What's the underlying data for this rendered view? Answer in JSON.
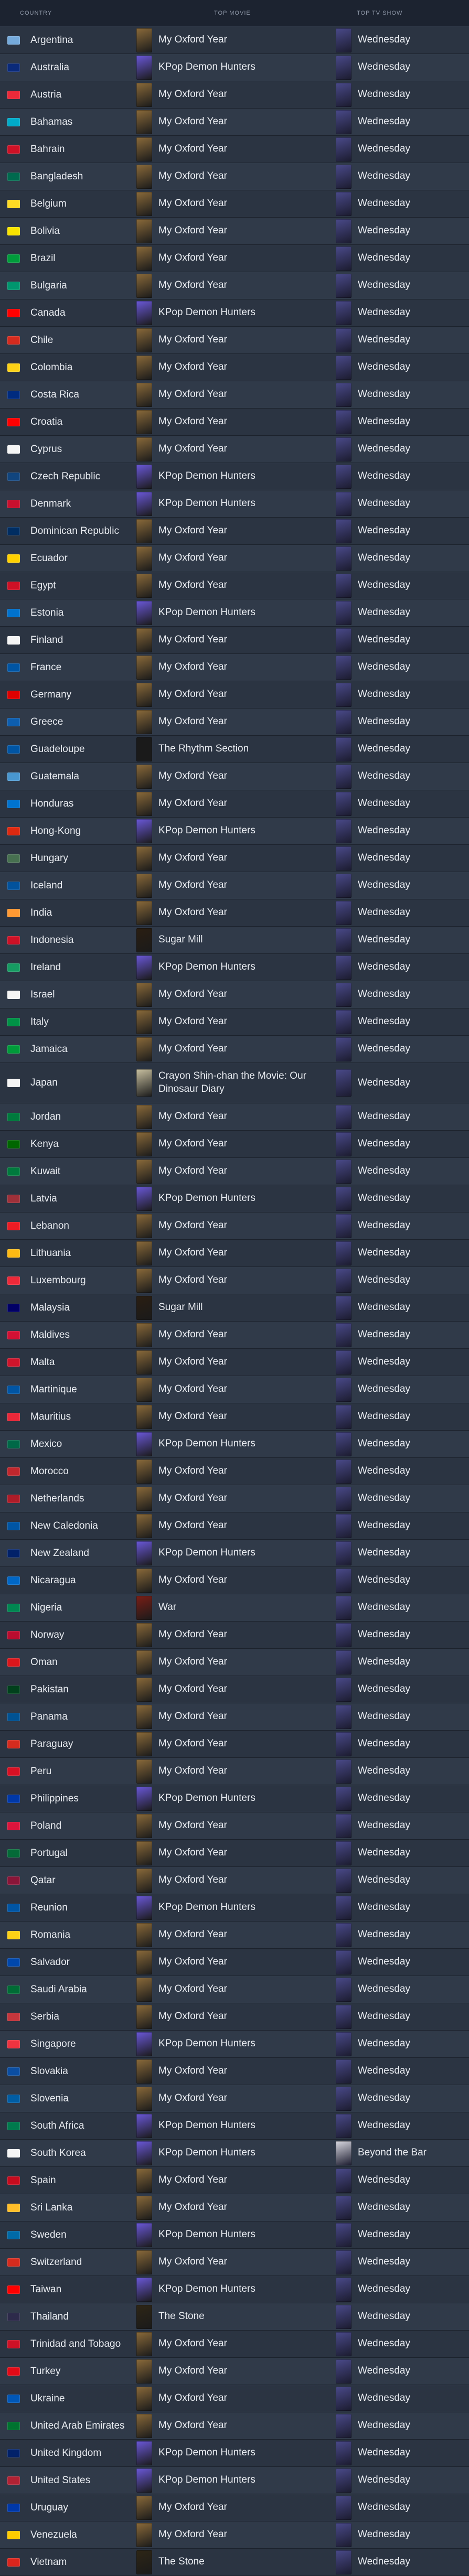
{
  "headers": {
    "country": "COUNTRY",
    "movie": "TOP MOVIE",
    "show": "TOP TV SHOW"
  },
  "posters": {
    "my_oxford_year": "#8a6a3a",
    "kpop_demon_hunters": "#6a58d8",
    "wednesday": "#4a4a8a",
    "rhythm_section": "#1a1a1a",
    "sugar_mill": "#2a1e12",
    "crayon_shinchan": "#c8c0a0",
    "war": "#7a1e16",
    "the_stone": "#2e2616",
    "beyond_the_bar": "#d8d8e0"
  },
  "rows": [
    {
      "country": "Argentina",
      "movie": "My Oxford Year",
      "show": "Wednesday",
      "flag": "#75aadb"
    },
    {
      "country": "Australia",
      "movie": "KPop Demon Hunters",
      "show": "Wednesday",
      "flag": "#0a2a7a"
    },
    {
      "country": "Austria",
      "movie": "My Oxford Year",
      "show": "Wednesday",
      "flag": "#ed2939"
    },
    {
      "country": "Bahamas",
      "movie": "My Oxford Year",
      "show": "Wednesday",
      "flag": "#00abc9"
    },
    {
      "country": "Bahrain",
      "movie": "My Oxford Year",
      "show": "Wednesday",
      "flag": "#ce1126"
    },
    {
      "country": "Bangladesh",
      "movie": "My Oxford Year",
      "show": "Wednesday",
      "flag": "#006a4e"
    },
    {
      "country": "Belgium",
      "movie": "My Oxford Year",
      "show": "Wednesday",
      "flag": "#fdda24"
    },
    {
      "country": "Bolivia",
      "movie": "My Oxford Year",
      "show": "Wednesday",
      "flag": "#f9e300"
    },
    {
      "country": "Brazil",
      "movie": "My Oxford Year",
      "show": "Wednesday",
      "flag": "#009c3b"
    },
    {
      "country": "Bulgaria",
      "movie": "My Oxford Year",
      "show": "Wednesday",
      "flag": "#00966e"
    },
    {
      "country": "Canada",
      "movie": "KPop Demon Hunters",
      "show": "Wednesday",
      "flag": "#ff0000"
    },
    {
      "country": "Chile",
      "movie": "My Oxford Year",
      "show": "Wednesday",
      "flag": "#d52b1e"
    },
    {
      "country": "Colombia",
      "movie": "My Oxford Year",
      "show": "Wednesday",
      "flag": "#fcd116"
    },
    {
      "country": "Costa Rica",
      "movie": "My Oxford Year",
      "show": "Wednesday",
      "flag": "#002b7f"
    },
    {
      "country": "Croatia",
      "movie": "My Oxford Year",
      "show": "Wednesday",
      "flag": "#ff0000"
    },
    {
      "country": "Cyprus",
      "movie": "My Oxford Year",
      "show": "Wednesday",
      "flag": "#f5f5f5"
    },
    {
      "country": "Czech Republic",
      "movie": "KPop Demon Hunters",
      "show": "Wednesday",
      "flag": "#11457e"
    },
    {
      "country": "Denmark",
      "movie": "KPop Demon Hunters",
      "show": "Wednesday",
      "flag": "#c8102e"
    },
    {
      "country": "Dominican Republic",
      "movie": "My Oxford Year",
      "show": "Wednesday",
      "flag": "#002d62"
    },
    {
      "country": "Ecuador",
      "movie": "My Oxford Year",
      "show": "Wednesday",
      "flag": "#ffd100"
    },
    {
      "country": "Egypt",
      "movie": "My Oxford Year",
      "show": "Wednesday",
      "flag": "#ce1126"
    },
    {
      "country": "Estonia",
      "movie": "KPop Demon Hunters",
      "show": "Wednesday",
      "flag": "#0072ce"
    },
    {
      "country": "Finland",
      "movie": "My Oxford Year",
      "show": "Wednesday",
      "flag": "#f5f5f5"
    },
    {
      "country": "France",
      "movie": "My Oxford Year",
      "show": "Wednesday",
      "flag": "#0055a4"
    },
    {
      "country": "Germany",
      "movie": "My Oxford Year",
      "show": "Wednesday",
      "flag": "#dd0000"
    },
    {
      "country": "Greece",
      "movie": "My Oxford Year",
      "show": "Wednesday",
      "flag": "#0d5eaf"
    },
    {
      "country": "Guadeloupe",
      "movie": "The Rhythm Section",
      "show": "Wednesday",
      "flag": "#0055a4",
      "poster": "rhythm_section"
    },
    {
      "country": "Guatemala",
      "movie": "My Oxford Year",
      "show": "Wednesday",
      "flag": "#4997d0"
    },
    {
      "country": "Honduras",
      "movie": "My Oxford Year",
      "show": "Wednesday",
      "flag": "#0073cf"
    },
    {
      "country": "Hong-Kong",
      "movie": "KPop Demon Hunters",
      "show": "Wednesday",
      "flag": "#de2910"
    },
    {
      "country": "Hungary",
      "movie": "My Oxford Year",
      "show": "Wednesday",
      "flag": "#477050"
    },
    {
      "country": "Iceland",
      "movie": "My Oxford Year",
      "show": "Wednesday",
      "flag": "#02529c"
    },
    {
      "country": "India",
      "movie": "My Oxford Year",
      "show": "Wednesday",
      "flag": "#ff9933"
    },
    {
      "country": "Indonesia",
      "movie": "Sugar Mill",
      "show": "Wednesday",
      "flag": "#ce1126",
      "poster": "sugar_mill"
    },
    {
      "country": "Ireland",
      "movie": "KPop Demon Hunters",
      "show": "Wednesday",
      "flag": "#169b62"
    },
    {
      "country": "Israel",
      "movie": "My Oxford Year",
      "show": "Wednesday",
      "flag": "#f5f5f5"
    },
    {
      "country": "Italy",
      "movie": "My Oxford Year",
      "show": "Wednesday",
      "flag": "#009246"
    },
    {
      "country": "Jamaica",
      "movie": "My Oxford Year",
      "show": "Wednesday",
      "flag": "#009b3a"
    },
    {
      "country": "Japan",
      "movie": "Crayon Shin-chan the Movie: Our Dinosaur Diary",
      "show": "Wednesday",
      "flag": "#f5f5f5",
      "poster": "crayon_shinchan",
      "tall": true
    },
    {
      "country": "Jordan",
      "movie": "My Oxford Year",
      "show": "Wednesday",
      "flag": "#007a3d"
    },
    {
      "country": "Kenya",
      "movie": "My Oxford Year",
      "show": "Wednesday",
      "flag": "#006600"
    },
    {
      "country": "Kuwait",
      "movie": "My Oxford Year",
      "show": "Wednesday",
      "flag": "#007a3d"
    },
    {
      "country": "Latvia",
      "movie": "KPop Demon Hunters",
      "show": "Wednesday",
      "flag": "#9e3039"
    },
    {
      "country": "Lebanon",
      "movie": "My Oxford Year",
      "show": "Wednesday",
      "flag": "#ed1c24"
    },
    {
      "country": "Lithuania",
      "movie": "My Oxford Year",
      "show": "Wednesday",
      "flag": "#fdb913"
    },
    {
      "country": "Luxembourg",
      "movie": "My Oxford Year",
      "show": "Wednesday",
      "flag": "#ed2939"
    },
    {
      "country": "Malaysia",
      "movie": "Sugar Mill",
      "show": "Wednesday",
      "flag": "#010066",
      "poster": "sugar_mill"
    },
    {
      "country": "Maldives",
      "movie": "My Oxford Year",
      "show": "Wednesday",
      "flag": "#d21034"
    },
    {
      "country": "Malta",
      "movie": "My Oxford Year",
      "show": "Wednesday",
      "flag": "#cf142b"
    },
    {
      "country": "Martinique",
      "movie": "My Oxford Year",
      "show": "Wednesday",
      "flag": "#0055a4"
    },
    {
      "country": "Mauritius",
      "movie": "My Oxford Year",
      "show": "Wednesday",
      "flag": "#ea2839"
    },
    {
      "country": "Mexico",
      "movie": "KPop Demon Hunters",
      "show": "Wednesday",
      "flag": "#006847"
    },
    {
      "country": "Morocco",
      "movie": "My Oxford Year",
      "show": "Wednesday",
      "flag": "#c1272d"
    },
    {
      "country": "Netherlands",
      "movie": "My Oxford Year",
      "show": "Wednesday",
      "flag": "#ae1c28"
    },
    {
      "country": "New Caledonia",
      "movie": "My Oxford Year",
      "show": "Wednesday",
      "flag": "#0055a4"
    },
    {
      "country": "New Zealand",
      "movie": "KPop Demon Hunters",
      "show": "Wednesday",
      "flag": "#012169"
    },
    {
      "country": "Nicaragua",
      "movie": "My Oxford Year",
      "show": "Wednesday",
      "flag": "#0067c6"
    },
    {
      "country": "Nigeria",
      "movie": "War",
      "show": "Wednesday",
      "flag": "#008751",
      "poster": "war"
    },
    {
      "country": "Norway",
      "movie": "My Oxford Year",
      "show": "Wednesday",
      "flag": "#ba0c2f"
    },
    {
      "country": "Oman",
      "movie": "My Oxford Year",
      "show": "Wednesday",
      "flag": "#db161b"
    },
    {
      "country": "Pakistan",
      "movie": "My Oxford Year",
      "show": "Wednesday",
      "flag": "#01411c"
    },
    {
      "country": "Panama",
      "movie": "My Oxford Year",
      "show": "Wednesday",
      "flag": "#005293"
    },
    {
      "country": "Paraguay",
      "movie": "My Oxford Year",
      "show": "Wednesday",
      "flag": "#d52b1e"
    },
    {
      "country": "Peru",
      "movie": "My Oxford Year",
      "show": "Wednesday",
      "flag": "#d91023"
    },
    {
      "country": "Philippines",
      "movie": "KPop Demon Hunters",
      "show": "Wednesday",
      "flag": "#0038a8"
    },
    {
      "country": "Poland",
      "movie": "My Oxford Year",
      "show": "Wednesday",
      "flag": "#dc143c"
    },
    {
      "country": "Portugal",
      "movie": "My Oxford Year",
      "show": "Wednesday",
      "flag": "#046a38"
    },
    {
      "country": "Qatar",
      "movie": "My Oxford Year",
      "show": "Wednesday",
      "flag": "#8a1538"
    },
    {
      "country": "Reunion",
      "movie": "KPop Demon Hunters",
      "show": "Wednesday",
      "flag": "#0055a4"
    },
    {
      "country": "Romania",
      "movie": "My Oxford Year",
      "show": "Wednesday",
      "flag": "#fcd116"
    },
    {
      "country": "Salvador",
      "movie": "My Oxford Year",
      "show": "Wednesday",
      "flag": "#0047ab"
    },
    {
      "country": "Saudi Arabia",
      "movie": "My Oxford Year",
      "show": "Wednesday",
      "flag": "#006c35"
    },
    {
      "country": "Serbia",
      "movie": "My Oxford Year",
      "show": "Wednesday",
      "flag": "#c6363c"
    },
    {
      "country": "Singapore",
      "movie": "KPop Demon Hunters",
      "show": "Wednesday",
      "flag": "#ef3340"
    },
    {
      "country": "Slovakia",
      "movie": "My Oxford Year",
      "show": "Wednesday",
      "flag": "#0b4ea2"
    },
    {
      "country": "Slovenia",
      "movie": "My Oxford Year",
      "show": "Wednesday",
      "flag": "#005da4"
    },
    {
      "country": "South Africa",
      "movie": "KPop Demon Hunters",
      "show": "Wednesday",
      "flag": "#007a4d"
    },
    {
      "country": "South Korea",
      "movie": "KPop Demon Hunters",
      "show": "Beyond the Bar",
      "flag": "#f5f5f5",
      "show_poster": "beyond_the_bar"
    },
    {
      "country": "Spain",
      "movie": "My Oxford Year",
      "show": "Wednesday",
      "flag": "#c60b1e"
    },
    {
      "country": "Sri Lanka",
      "movie": "My Oxford Year",
      "show": "Wednesday",
      "flag": "#ffbe29"
    },
    {
      "country": "Sweden",
      "movie": "KPop Demon Hunters",
      "show": "Wednesday",
      "flag": "#006aa7"
    },
    {
      "country": "Switzerland",
      "movie": "My Oxford Year",
      "show": "Wednesday",
      "flag": "#d52b1e"
    },
    {
      "country": "Taiwan",
      "movie": "KPop Demon Hunters",
      "show": "Wednesday",
      "flag": "#fe0000"
    },
    {
      "country": "Thailand",
      "movie": "The Stone",
      "show": "Wednesday",
      "flag": "#2d2a4a",
      "poster": "the_stone"
    },
    {
      "country": "Trinidad and Tobago",
      "movie": "My Oxford Year",
      "show": "Wednesday",
      "flag": "#ce1126"
    },
    {
      "country": "Turkey",
      "movie": "My Oxford Year",
      "show": "Wednesday",
      "flag": "#e30a17"
    },
    {
      "country": "Ukraine",
      "movie": "My Oxford Year",
      "show": "Wednesday",
      "flag": "#0057b7"
    },
    {
      "country": "United Arab Emirates",
      "movie": "My Oxford Year",
      "show": "Wednesday",
      "flag": "#00732f"
    },
    {
      "country": "United Kingdom",
      "movie": "KPop Demon Hunters",
      "show": "Wednesday",
      "flag": "#012169"
    },
    {
      "country": "United States",
      "movie": "KPop Demon Hunters",
      "show": "Wednesday",
      "flag": "#b22234"
    },
    {
      "country": "Uruguay",
      "movie": "My Oxford Year",
      "show": "Wednesday",
      "flag": "#0038a8"
    },
    {
      "country": "Venezuela",
      "movie": "My Oxford Year",
      "show": "Wednesday",
      "flag": "#ffcc00"
    },
    {
      "country": "Vietnam",
      "movie": "The Stone",
      "show": "Wednesday",
      "flag": "#da251d",
      "poster": "the_stone"
    }
  ]
}
